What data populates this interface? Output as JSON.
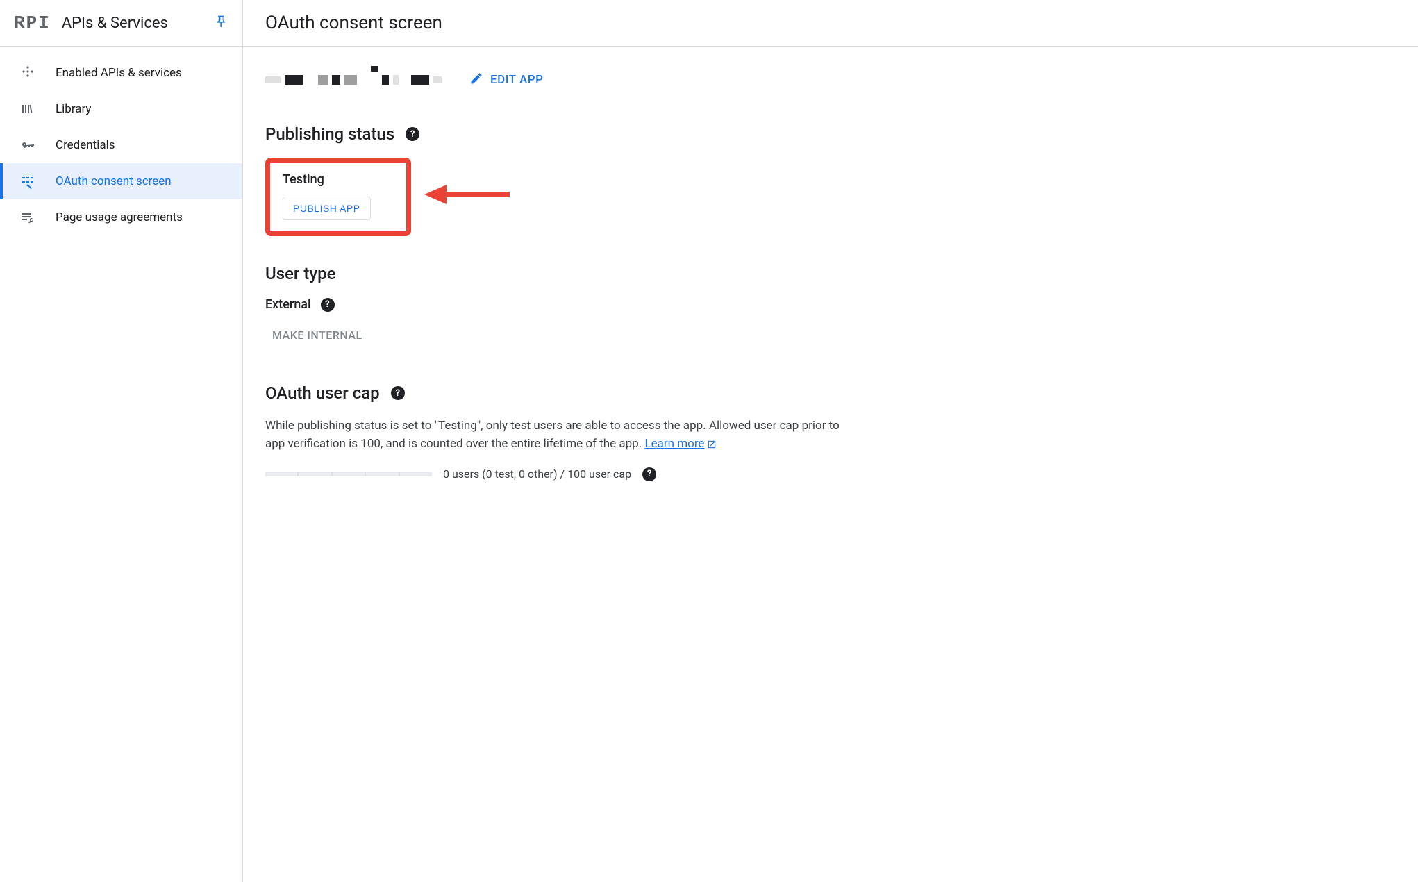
{
  "sidebar": {
    "logo": "RPI",
    "title": "APIs & Services",
    "items": [
      {
        "label": "Enabled APIs & services",
        "active": false
      },
      {
        "label": "Library",
        "active": false
      },
      {
        "label": "Credentials",
        "active": false
      },
      {
        "label": "OAuth consent screen",
        "active": true
      },
      {
        "label": "Page usage agreements",
        "active": false
      }
    ]
  },
  "header": {
    "title": "OAuth consent screen"
  },
  "main": {
    "edit_app_label": "EDIT APP",
    "publishing": {
      "heading": "Publishing status",
      "status_label": "Testing",
      "publish_button": "PUBLISH APP"
    },
    "user_type": {
      "heading": "User type",
      "value": "External",
      "make_internal_button": "MAKE INTERNAL"
    },
    "user_cap": {
      "heading": "OAuth user cap",
      "description": "While publishing status is set to \"Testing\", only test users are able to access the app. Allowed user cap prior to app verification is 100, and is counted over the entire lifetime of the app.",
      "learn_more": "Learn more",
      "usage_text": "0 users (0 test, 0 other) / 100 user cap"
    }
  }
}
